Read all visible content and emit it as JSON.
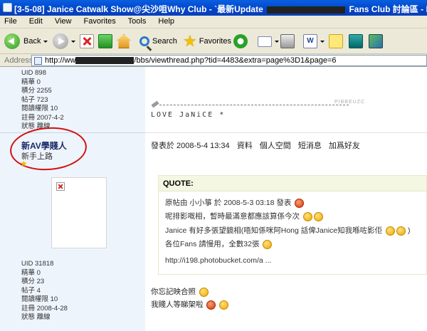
{
  "window": {
    "title_part1": "[3-5-08] Janice Catwalk Show@尖沙咀Why Club - `最新Update",
    "title_part2": "Fans Club 討論區 - Powered"
  },
  "menu": [
    "File",
    "Edit",
    "View",
    "Favorites",
    "Tools",
    "Help"
  ],
  "toolbar": {
    "back_label": "Back",
    "search_label": "Search",
    "favorites_label": "Favorites"
  },
  "address": {
    "label": "Address",
    "url_prefix": "http://ww",
    "url_suffix": "/bbs/viewthread.php?tid=4483&extra=page%3D1&page=6"
  },
  "poster1": {
    "stats": [
      "UID 898",
      "精華 0",
      "積分 2255",
      "帖子 723",
      "閱讀權限 10",
      "註冊 2007-4-2",
      "狀態 離線"
    ]
  },
  "signature": {
    "text": "LOVE  JaNiCE *",
    "tag": "PIBBEUZC"
  },
  "poster2": {
    "username": "新AV學賤人",
    "rank": "新手上路",
    "stats": [
      "UID 31818",
      "精華 0",
      "積分 23",
      "帖子 4",
      "閱讀權限 10",
      "註冊 2008-4-28",
      "狀態 離線"
    ]
  },
  "post": {
    "posted_at": "發表於 2008-5-4 13:34",
    "actions": [
      "資料",
      "個人空間",
      "短消息",
      "加爲好友"
    ],
    "quote": {
      "header": "QUOTE:",
      "author_line": "原帖由 小小箏 於 2008-5-3 03:18 發表",
      "line1": "呢排影嘅相，暫時最滿意都應該算係今次",
      "line2": "Janice 有好多張望鏡相(唔知係咪阿Hong 話俾Janice知我喺咗影佢",
      "line2_end": ")",
      "line3": "各位Fans 請慢用，全數32張",
      "link": "http://i198.photobucket.com/a ..."
    },
    "reply1": "你忘記映合照",
    "reply2": "我賤人等睇架啦"
  }
}
